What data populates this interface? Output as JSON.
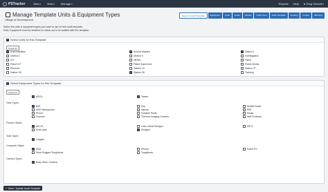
{
  "nav": {
    "brand": "PSTracker",
    "menu": [
      "New",
      "View",
      "Manage"
    ],
    "reports": "Reports",
    "help": "Help",
    "user": "Greg Glickoff"
  },
  "page": {
    "title": "Manage Template Units & Equipment Types",
    "subtitle": "Village of Development",
    "instructions": [
      "Select the units & equipment types you want to use for this audit template.",
      "Note: Equipment must be enabled for check out to be audited with this template."
    ]
  },
  "tabs": [
    {
      "label": "Return to Audit Template",
      "primary": true
    },
    {
      "label": "Equipment",
      "primary": false
    },
    {
      "label": "Units",
      "primary": false
    },
    {
      "label": "Areas",
      "primary": false
    },
    {
      "label": "Vehicle",
      "primary": false
    },
    {
      "label": "Indent Sum",
      "primary": false
    },
    {
      "label": "Audit Template",
      "primary": false
    },
    {
      "label": "Funding",
      "primary": false
    },
    {
      "label": "Vendor",
      "primary": false
    },
    {
      "label": "Warranty",
      "primary": false
    }
  ],
  "units_section": {
    "header": "Select Units for this Template",
    "check_all": "Check All",
    "columns": [
      [
        {
          "label": "Administration",
          "checked": true
        },
        {
          "label": "District 2",
          "checked": false
        },
        {
          "label": "ICF",
          "checked": false
        },
        {
          "label": "Patrol ICT",
          "checked": false
        },
        {
          "label": "Records",
          "checked": false
        },
        {
          "label": "Station 30",
          "checked": false
        }
      ],
      [
        {
          "label": "Animal Warden",
          "checked": true
        },
        {
          "label": "District 3",
          "checked": false
        },
        {
          "label": "NEMA",
          "checked": false
        },
        {
          "label": "Patrol Supervisor",
          "checked": false
        },
        {
          "label": "Station 19",
          "checked": false
        },
        {
          "label": "Station 30",
          "checked": true
        }
      ],
      [
        {
          "label": "District 1",
          "checked": true
        },
        {
          "label": "Investigation",
          "checked": false
        },
        {
          "label": "Patrol",
          "checked": false
        },
        {
          "label": "Public Works",
          "checked": false
        },
        {
          "label": "Station 27",
          "checked": false
        },
        {
          "label": "Training",
          "checked": false
        }
      ]
    ]
  },
  "equipment_section": {
    "header": "Select Equipment Types for this Template",
    "check_all": "Check All",
    "groups": [
      {
        "name": "",
        "items": [
          {
            "label": "AED's",
            "checked": true,
            "col": 0
          },
          {
            "label": "Tasers",
            "checked": true,
            "col": 1
          }
        ]
      },
      {
        "name": "Gear Types",
        "items": [
          {
            "label": "Belt",
            "checked": true,
            "col": 0
          },
          {
            "label": "Key",
            "checked": false,
            "col": 1
          },
          {
            "label": "Mobile Radio",
            "checked": false,
            "col": 2
          },
          {
            "label": "MVR Microphone",
            "checked": false,
            "col": 0
          },
          {
            "label": "Narcan",
            "checked": false,
            "col": 1
          },
          {
            "label": "PBT",
            "checked": false,
            "col": 2
          },
          {
            "label": "Phone",
            "checked": false,
            "col": 0
          },
          {
            "label": "Portable Radio",
            "checked": false,
            "col": 1
          },
          {
            "label": "Radar",
            "checked": false,
            "col": 2
          },
          {
            "label": "Scanner",
            "checked": false,
            "col": 0
          },
          {
            "label": "Thermal Imaging Camera",
            "checked": false,
            "col": 1
          },
          {
            "label": "Wet Protector",
            "checked": false,
            "col": 2
          }
        ]
      },
      {
        "name": "Firearm Styles",
        "items": [
          {
            "label": "AR-15",
            "checked": true,
            "col": 0
          },
          {
            "label": "Less Lethal Shotgun",
            "checked": false,
            "col": 1
          },
          {
            "label": "MP-5",
            "checked": false,
            "col": 2
          },
          {
            "label": "Semi-auto",
            "checked": false,
            "col": 0
          },
          {
            "label": "Shotgun",
            "checked": true,
            "col": 1
          }
        ]
      },
      {
        "name": "Tank Types",
        "items": [
          {
            "label": "Oxygen",
            "checked": true,
            "col": 0
          }
        ]
      },
      {
        "name": "Computer Styles",
        "items": [
          {
            "label": "iPad",
            "checked": true,
            "col": 0
          },
          {
            "label": "iPhone",
            "checked": false,
            "col": 1
          },
          {
            "label": "Patrol PC",
            "checked": false,
            "col": 2
          },
          {
            "label": "Semi-Rugged Toughbook",
            "checked": false,
            "col": 0
          },
          {
            "label": "Toughbook",
            "checked": false,
            "col": 1
          }
        ]
      },
      {
        "name": "Camera Types",
        "items": [
          {
            "label": "Body Worn Camera",
            "checked": true,
            "col": 0
          }
        ]
      }
    ]
  },
  "save_button": "Save / Update Audit Template",
  "colors": {
    "navbar": "#2b3542",
    "accent": "#2f6db5"
  }
}
